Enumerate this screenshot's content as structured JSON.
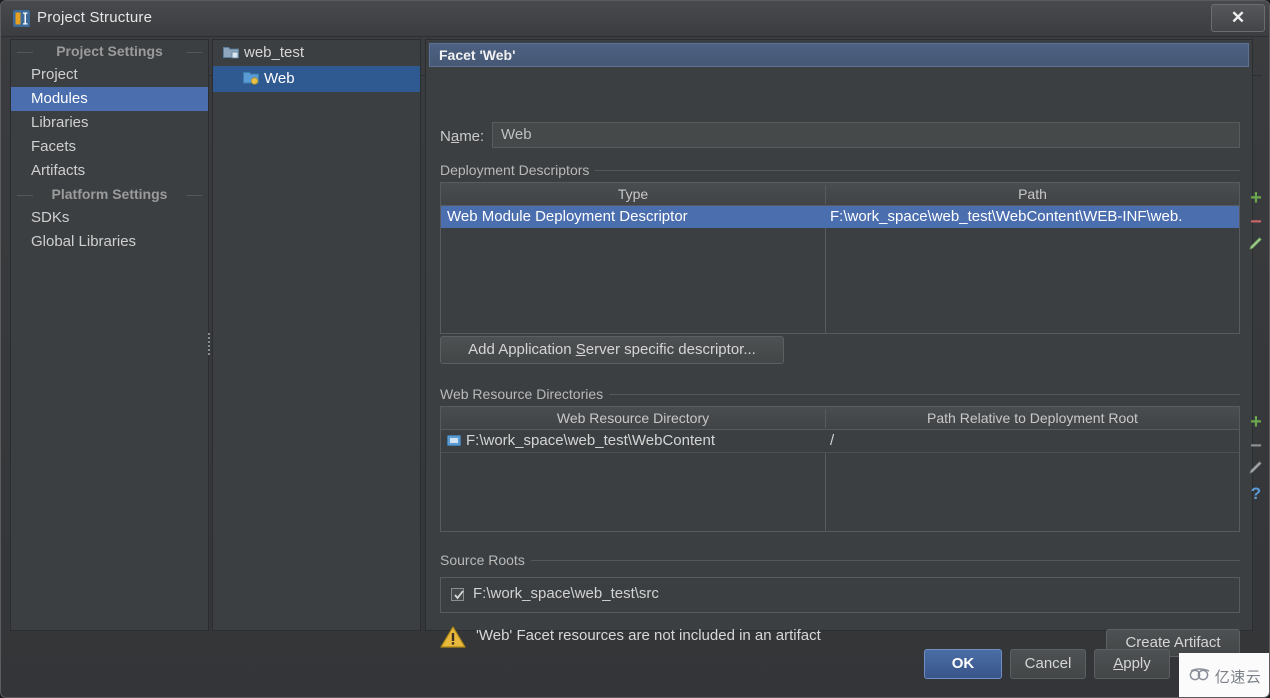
{
  "window": {
    "title": "Project Structure",
    "app_icon": "intellij-icon",
    "close_label": "✕"
  },
  "toolbar": {
    "nav": [
      {
        "name": "back-arrow-icon",
        "glyph": "⬅",
        "enabled": true
      },
      {
        "name": "forward-arrow-icon",
        "glyph": "➡",
        "enabled": false
      }
    ],
    "actions": [
      {
        "name": "add-icon",
        "glyph": "+",
        "color": "#6aa84f"
      },
      {
        "name": "remove-icon",
        "glyph": "−",
        "color": "#cc6666"
      },
      {
        "name": "copy-icon",
        "glyph": "❐",
        "color": "#9a9d9f"
      },
      {
        "name": "search-icon",
        "glyph": "⌕",
        "color": "#8fa8bf"
      },
      {
        "name": "expand-all-icon",
        "glyph": "⤓",
        "color": "#8fa8bf"
      },
      {
        "name": "collapse-all-icon",
        "glyph": "⤒",
        "color": "#8fa8bf"
      }
    ]
  },
  "sidebar": {
    "groups": [
      {
        "header": "Project Settings",
        "items": [
          {
            "label": "Project",
            "selected": false
          },
          {
            "label": "Modules",
            "selected": true
          },
          {
            "label": "Libraries",
            "selected": false
          },
          {
            "label": "Facets",
            "selected": false
          },
          {
            "label": "Artifacts",
            "selected": false
          }
        ]
      },
      {
        "header": "Platform Settings",
        "items": [
          {
            "label": "SDKs",
            "selected": false
          },
          {
            "label": "Global Libraries",
            "selected": false
          }
        ]
      }
    ]
  },
  "tree": {
    "nodes": [
      {
        "label": "web_test",
        "icon": "module-folder-icon",
        "selected": false,
        "child": false
      },
      {
        "label": "Web",
        "icon": "web-facet-icon",
        "selected": true,
        "child": true
      }
    ]
  },
  "main": {
    "facet_header": "Facet 'Web'",
    "name_label_pre": "N",
    "name_label_mnemonic": "a",
    "name_label_post": "me:",
    "name_value": "Web",
    "name_placeholder": "",
    "deployment": {
      "section_title": "Deployment Descriptors",
      "columns": [
        "Type",
        "Path"
      ],
      "rows": [
        {
          "type": "Web Module Deployment Descriptor",
          "path": "F:\\work_space\\web_test\\WebContent\\WEB-INF\\web.",
          "selected": true
        }
      ],
      "actions": [
        {
          "name": "add-descriptor-icon",
          "glyph": "+",
          "color": "#6aa84f"
        },
        {
          "name": "remove-descriptor-icon",
          "glyph": "−",
          "color": "#cc6666"
        },
        {
          "name": "edit-descriptor-icon",
          "glyph": "✎",
          "color": "#9fd18a"
        }
      ],
      "add_button_pre": "Add Application ",
      "add_button_mnemonic": "S",
      "add_button_post": "erver specific descriptor..."
    },
    "web_resources": {
      "section_title": "Web Resource Directories",
      "columns": [
        "Web Resource Directory",
        "Path Relative to Deployment Root"
      ],
      "rows": [
        {
          "directory": "F:\\work_space\\web_test\\WebContent",
          "relative_path": "/",
          "icon": "folder-icon"
        }
      ],
      "actions": [
        {
          "name": "add-resource-icon",
          "glyph": "+",
          "color": "#6aa84f"
        },
        {
          "name": "remove-resource-icon",
          "glyph": "−",
          "color": "#8d9093"
        },
        {
          "name": "edit-resource-icon",
          "glyph": "✎",
          "color": "#9a9d9f"
        },
        {
          "name": "help-icon",
          "glyph": "?",
          "color": "#5b9bd5"
        }
      ]
    },
    "source_roots": {
      "section_title": "Source Roots",
      "items": [
        {
          "label": "F:\\work_space\\web_test\\src",
          "checked": true
        }
      ]
    },
    "warning": {
      "icon": "warning-icon",
      "text": "'Web' Facet resources are not included in an artifact",
      "button_label": "Create Artifact"
    }
  },
  "footer": {
    "buttons": [
      {
        "name": "ok-button",
        "label": "OK",
        "primary": true
      },
      {
        "name": "cancel-button",
        "label": "Cancel",
        "primary": false
      },
      {
        "name": "apply-button",
        "label_pre": "",
        "mnemonic": "A",
        "label_post": "pply",
        "primary": false
      }
    ]
  },
  "watermark": {
    "text": "亿速云",
    "logo": "cloud-logo-icon"
  }
}
